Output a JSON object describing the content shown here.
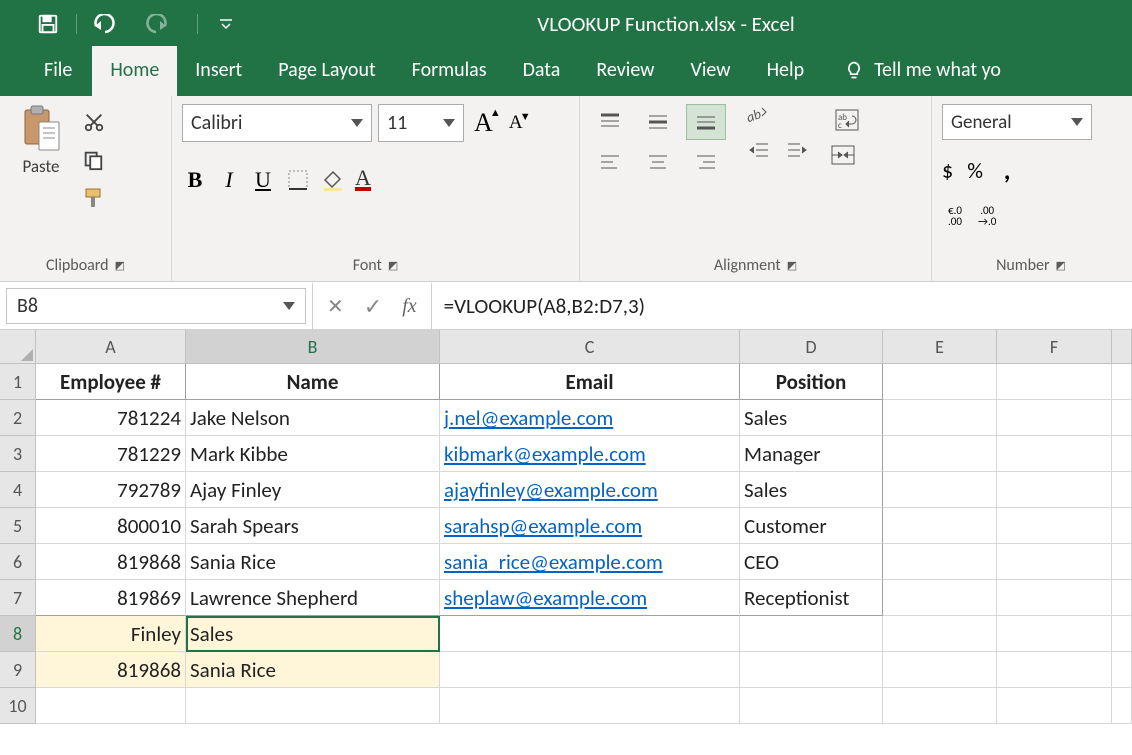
{
  "title": "VLOOKUP Function.xlsx  -  Excel",
  "tabs": {
    "file": "File",
    "home": "Home",
    "insert": "Insert",
    "pagelayout": "Page Layout",
    "formulas": "Formulas",
    "data": "Data",
    "review": "Review",
    "view": "View",
    "help": "Help",
    "tellme": "Tell me what yo"
  },
  "ribbon": {
    "clipboard": {
      "label": "Clipboard",
      "paste": "Paste"
    },
    "font": {
      "label": "Font",
      "name": "Calibri",
      "size": "11",
      "bold": "B",
      "italic": "I",
      "underline": "U"
    },
    "alignment": {
      "label": "Alignment"
    },
    "number": {
      "label": "Number",
      "format": "General",
      "currency": "$",
      "percent": "%",
      "comma": ",",
      "inc_dec": "€.0",
      "dec_inc": ".00",
      "inc_dec2": ".00",
      "dec_inc2": "→.0"
    }
  },
  "formulaBar": {
    "nameBox": "B8",
    "fx": "fx",
    "formula": "=VLOOKUP(A8,B2:D7,3)"
  },
  "columns": [
    "A",
    "B",
    "C",
    "D",
    "E",
    "F"
  ],
  "rows": [
    "1",
    "2",
    "3",
    "4",
    "5",
    "6",
    "7",
    "8",
    "9",
    "10"
  ],
  "activeCol": "B",
  "activeRow": "8",
  "grid": {
    "headers": {
      "A": "Employee #",
      "B": "Name",
      "C": "Email",
      "D": "Position"
    },
    "data": [
      {
        "emp": "781224",
        "name": "Jake Nelson",
        "email": "j.nel@example.com",
        "pos": "Sales"
      },
      {
        "emp": "781229",
        "name": "Mark Kibbe",
        "email": "kibmark@example.com",
        "pos": "Manager"
      },
      {
        "emp": "792789",
        "name": "Ajay Finley",
        "email": "ajayfinley@example.com",
        "pos": "Sales"
      },
      {
        "emp": "800010",
        "name": "Sarah Spears",
        "email": "sarahsp@example.com",
        "pos": "Customer"
      },
      {
        "emp": "819868",
        "name": "Sania Rice",
        "email": "sania_rice@example.com",
        "pos": "CEO"
      },
      {
        "emp": "819869",
        "name": "Lawrence Shepherd",
        "email": "sheplaw@example.com",
        "pos": "Receptionist"
      }
    ],
    "r8": {
      "A": "Finley",
      "B": "Sales"
    },
    "r9": {
      "A": "819868",
      "B": "Sania Rice"
    }
  }
}
